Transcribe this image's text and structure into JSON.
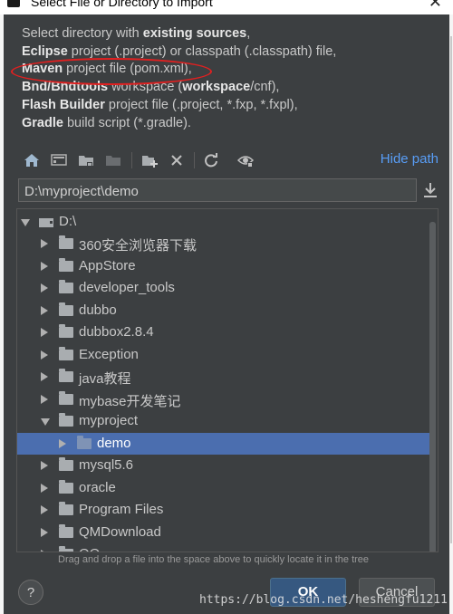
{
  "window": {
    "title": "Select File or Directory to Import",
    "close_glyph": "✕"
  },
  "description": {
    "line1": {
      "prefix": "Select directory with ",
      "bold": "existing sources",
      "suffix": ","
    },
    "line2": {
      "bold": "Eclipse",
      "suffix": " project (.project) or classpath (.classpath) file,"
    },
    "line3": {
      "bold": "Maven",
      "suffix": " project file (pom.xml),"
    },
    "line4": {
      "bold": "Bnd/Bndtools",
      "mid": " workspace (",
      "bold2": "workspace",
      "suffix": "/cnf),"
    },
    "line5": {
      "bold": "Flash Builder",
      "suffix": " project file (.project, *.fxp, *.fxpl),"
    },
    "line6": {
      "bold": "Gradle",
      "suffix": " build script (*.gradle)."
    },
    "annotation_color": "#e02020"
  },
  "toolbar": {
    "icons": [
      "home-icon",
      "desktop-icon",
      "project-folder-icon",
      "module-folder-icon",
      "new-folder-icon",
      "delete-icon",
      "refresh-icon",
      "show-hidden-icon"
    ],
    "hide_path_label": "Hide path"
  },
  "path_field": {
    "value": "D:\\myproject\\demo"
  },
  "tree": {
    "root": "D:\\",
    "items": [
      {
        "label": "360安全浏览器下载",
        "expanded": false
      },
      {
        "label": "AppStore",
        "expanded": false
      },
      {
        "label": "developer_tools",
        "expanded": false
      },
      {
        "label": "dubbo",
        "expanded": false
      },
      {
        "label": "dubbox2.8.4",
        "expanded": false
      },
      {
        "label": "Exception",
        "expanded": false
      },
      {
        "label": "java教程",
        "expanded": false
      },
      {
        "label": "mybase开发笔记",
        "expanded": false
      },
      {
        "label": "myproject",
        "expanded": true
      },
      {
        "label": "demo",
        "expanded": false,
        "selected": true,
        "child": true
      },
      {
        "label": "mysql5.6",
        "expanded": false
      },
      {
        "label": "oracle",
        "expanded": false
      },
      {
        "label": "Program Files",
        "expanded": false
      },
      {
        "label": "QMDownload",
        "expanded": false
      },
      {
        "label": "QQ",
        "expanded": false
      }
    ]
  },
  "hint": "Drag and drop a file into the space above to quickly locate it in the tree",
  "buttons": {
    "help": "?",
    "ok": "OK",
    "cancel": "Cancel"
  },
  "watermark": "https://blog.csdn.net/heshengfu1211",
  "colors": {
    "accent_link": "#589df6",
    "selection": "#4b6eaf",
    "background": "#3c3f41"
  }
}
